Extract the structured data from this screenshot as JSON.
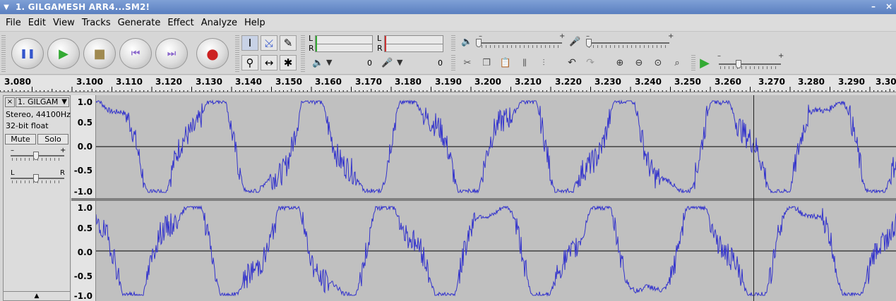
{
  "window": {
    "title": "1. GILGAMESH ARR4...SM2!",
    "menu_glyph": "▼",
    "minimize_glyph": "–",
    "close_glyph": "×"
  },
  "menus": [
    "File",
    "Edit",
    "View",
    "Tracks",
    "Generate",
    "Effect",
    "Analyze",
    "Help"
  ],
  "transport": {
    "pause": "❚❚",
    "play": "▶",
    "stop": "■",
    "skip_start": "⏮",
    "skip_end": "⏭",
    "record": "●"
  },
  "tools": {
    "selection": "I",
    "envelope": "⤩",
    "draw": "✎",
    "zoom": "⚲",
    "timeshift": "↔",
    "multi": "✱"
  },
  "meters": {
    "play_L": "L",
    "play_R": "R",
    "rec_L": "L",
    "rec_R": "R",
    "play_value": "0",
    "rec_value": "0"
  },
  "mixer": {
    "minus": "–",
    "plus": "+"
  },
  "ruler": {
    "labels": [
      "3.080",
      "3.100",
      "3.110",
      "3.120",
      "3.130",
      "3.140",
      "3.150",
      "3.160",
      "3.170",
      "3.180",
      "3.190",
      "3.200",
      "3.210",
      "3.220",
      "3.230",
      "3.240",
      "3.250",
      "3.260",
      "3.270",
      "3.280",
      "3.290",
      "3.30"
    ]
  },
  "track": {
    "close": "×",
    "name": "1. GILGAM",
    "name_arrow": "▼",
    "format": "Stereo, 44100Hz",
    "bitdepth": "32-bit float",
    "mute": "Mute",
    "solo": "Solo",
    "gain_minus": "–",
    "gain_plus": "+",
    "pan_L": "L",
    "pan_R": "R",
    "collapse": "▲"
  },
  "vruler_labels": [
    "1.0",
    "0.5",
    "0.0",
    "-0.5",
    "-1.0"
  ],
  "colors": {
    "waveform": "#3333cc",
    "wave_bg": "#c0c0c0",
    "titlebar": "#6a8ccc"
  }
}
